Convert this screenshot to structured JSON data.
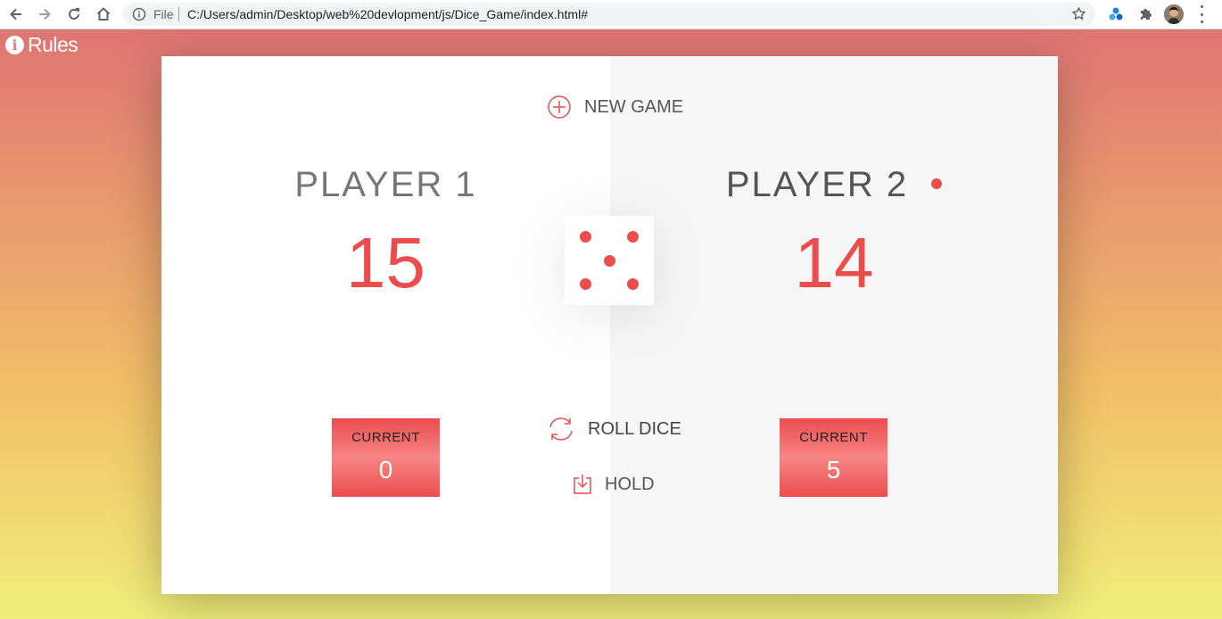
{
  "browser": {
    "file_label": "File",
    "url": "C:/Users/admin/Desktop/web%20devlopment/js/Dice_Game/index.html#"
  },
  "page": {
    "rules_label": "Rules",
    "new_game_label": "NEW GAME",
    "roll_dice_label": "ROLL DICE",
    "hold_label": "HOLD",
    "dice_value": 5,
    "active_player": 2,
    "accent_color": "#eb4d4d",
    "players": [
      {
        "name": "PLAYER 1",
        "score": "15",
        "current_label": "CURRENT",
        "current_value": "0"
      },
      {
        "name": "PLAYER 2",
        "score": "14",
        "current_label": "CURRENT",
        "current_value": "5"
      }
    ]
  }
}
